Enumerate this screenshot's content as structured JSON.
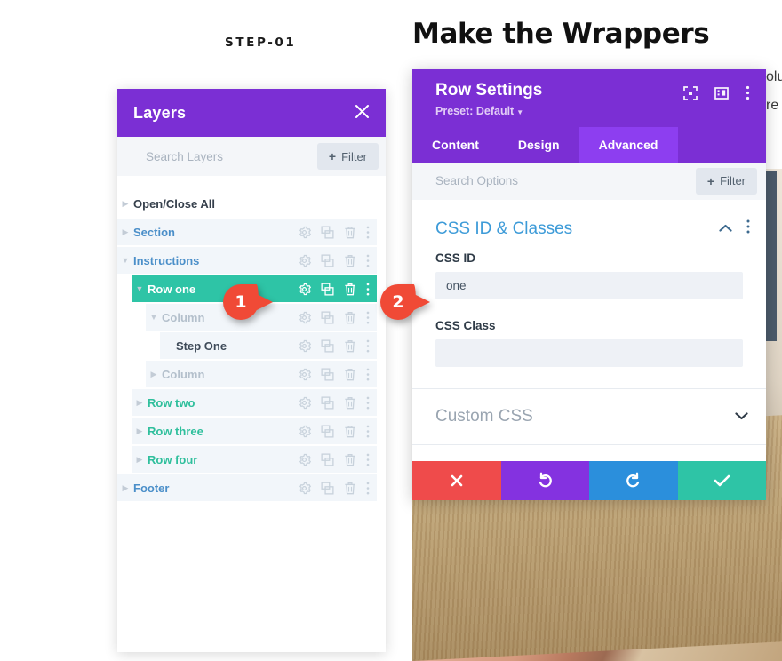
{
  "page": {
    "step_label": "STEP-01",
    "heading": "Make the Wrappers",
    "edge_text_1": "olu",
    "edge_text_2": "re"
  },
  "layers_panel": {
    "title": "Layers",
    "close_icon": "close-icon",
    "search_placeholder": "Search Layers",
    "filter_label": "Filter",
    "filter_plus": "+",
    "open_close_all": "Open/Close All",
    "rows": [
      {
        "label": "Section",
        "indent": 0,
        "style": "row-link",
        "caret": "right",
        "actions": true
      },
      {
        "label": "Instructions",
        "indent": 0,
        "style": "row-link",
        "caret": "down",
        "actions": true
      },
      {
        "label": "Row one",
        "indent": 1,
        "style": "row-selected",
        "caret": "down",
        "actions": true
      },
      {
        "label": "Column",
        "indent": 2,
        "style": "row-muted",
        "caret": "down",
        "actions": true
      },
      {
        "label": "Step One",
        "indent": 3,
        "style": "row-dark",
        "caret": "none",
        "actions": true
      },
      {
        "label": "Column",
        "indent": 2,
        "style": "row-muted",
        "caret": "right",
        "actions": true
      },
      {
        "label": "Row two",
        "indent": 1,
        "style": "row-green",
        "caret": "right",
        "actions": true
      },
      {
        "label": "Row three",
        "indent": 1,
        "style": "row-green",
        "caret": "right",
        "actions": true
      },
      {
        "label": "Row four",
        "indent": 1,
        "style": "row-green",
        "caret": "right",
        "actions": true
      },
      {
        "label": "Footer",
        "indent": 0,
        "style": "row-link",
        "caret": "right",
        "actions": true
      }
    ],
    "row_action_icons": [
      "gear-icon",
      "duplicate-icon",
      "trash-icon",
      "more-vertical-icon"
    ]
  },
  "settings_panel": {
    "title": "Row Settings",
    "preset": "Preset: Default",
    "header_icons": [
      "focus-icon",
      "layout-icon",
      "more-vertical-icon"
    ],
    "tabs": [
      {
        "label": "Content",
        "active": false
      },
      {
        "label": "Design",
        "active": false
      },
      {
        "label": "Advanced",
        "active": true
      }
    ],
    "search_placeholder": "Search Options",
    "filter_label": "Filter",
    "filter_plus": "+",
    "section": {
      "title": "CSS ID & Classes",
      "collapse_icon": "chevron-up-icon",
      "more_icon": "more-vertical-icon",
      "fields": [
        {
          "label": "CSS ID",
          "value": "one",
          "placeholder": ""
        },
        {
          "label": "CSS Class",
          "value": "",
          "placeholder": ""
        }
      ]
    },
    "collapsed_section": {
      "title": "Custom CSS",
      "expand_icon": "chevron-down-icon"
    },
    "footer_buttons": [
      {
        "name": "cancel-button",
        "icon": "x-icon",
        "color": "#ef4b4b"
      },
      {
        "name": "undo-button",
        "icon": "undo-icon",
        "color": "#8432e0"
      },
      {
        "name": "redo-button",
        "icon": "redo-icon",
        "color": "#2b8fdc"
      },
      {
        "name": "save-button",
        "icon": "check-icon",
        "color": "#2ec4a6"
      }
    ]
  },
  "callouts": [
    {
      "number": "1"
    },
    {
      "number": "2"
    }
  ],
  "colors": {
    "purple_header": "#7b2fd4",
    "purple_active_tab": "#8d3ef0",
    "green_selected": "#2ec4a6",
    "blue_link": "#4b8fc9",
    "section_title_blue": "#3d9bd8",
    "callout_red": "#f04a36"
  }
}
